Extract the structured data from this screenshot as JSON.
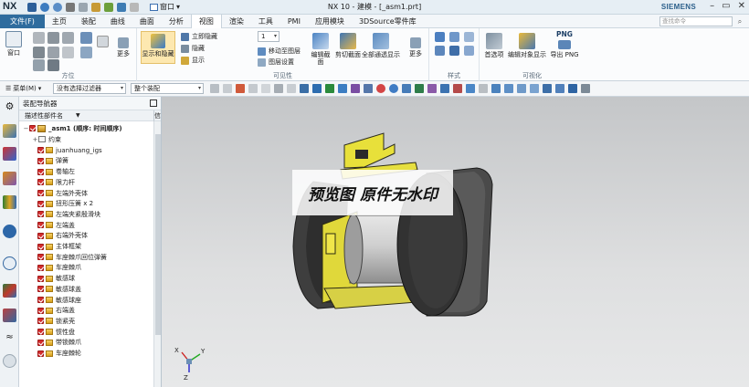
{
  "app": {
    "logo": "NX",
    "window_menu_label": "窗口",
    "title": "NX 10 - 建模 - [_asm1.prt]",
    "brand": "SIEMENS"
  },
  "menu": {
    "tabs": [
      "文件(F)",
      "主页",
      "装配",
      "曲线",
      "曲面",
      "分析",
      "视图",
      "渲染",
      "工具",
      "PMI",
      "应用模块",
      "3DSource零件库"
    ],
    "active_tab": "视图",
    "search_placeholder": "查找命令"
  },
  "ribbon": {
    "groups": {
      "orientation": "方位",
      "visibility": "可见性",
      "style": "样式",
      "visualization": "可视化"
    },
    "buttons": {
      "window": "窗口",
      "more1": "更多",
      "show_hide": "显示和隐藏",
      "immediate_hide": "立即隐藏",
      "hide": "隐藏",
      "show": "显示",
      "layer_value": "1",
      "move_to_layer": "移动至图层",
      "layer_settings": "图层设置",
      "edit_section": "编辑截面",
      "clip_section": "剪切截面",
      "all_pass_display": "全部通透显示",
      "more2": "更多",
      "preferences": "首选项",
      "edit_object_display": "编辑对象显示",
      "export_png": "导出 PNG",
      "png_badge": "PNG"
    }
  },
  "toolbar2": {
    "menu_label": "菜单(M)",
    "filter_value": "没有选择过滤器",
    "scope_value": "整个装配"
  },
  "navigator": {
    "title": "装配导航器",
    "column_header": "描述性部件名",
    "column_extra": "信",
    "root_label": "_asm1 (顺序: 时间顺序)",
    "constraints_label": "约束",
    "items": [
      "juanhuang_igs",
      "弹簧",
      "卷轴左",
      "限力杆",
      "左端外壳体",
      "扭形压簧 x 2",
      "左端夹紧殷滑块",
      "左端盖",
      "右端外壳体",
      "主体框架",
      "车座棘爪回位弹簧",
      "车座棘爪",
      "敏感球",
      "敏感球盖",
      "敏感球座",
      "右端盖",
      "锁紧壳",
      "惯性盘",
      "带锁棘爪",
      "车座棘轮"
    ]
  },
  "viewport": {
    "watermark": "预览图 原件无水印",
    "triad": {
      "x": "X",
      "y": "Y",
      "z": "Z"
    }
  }
}
